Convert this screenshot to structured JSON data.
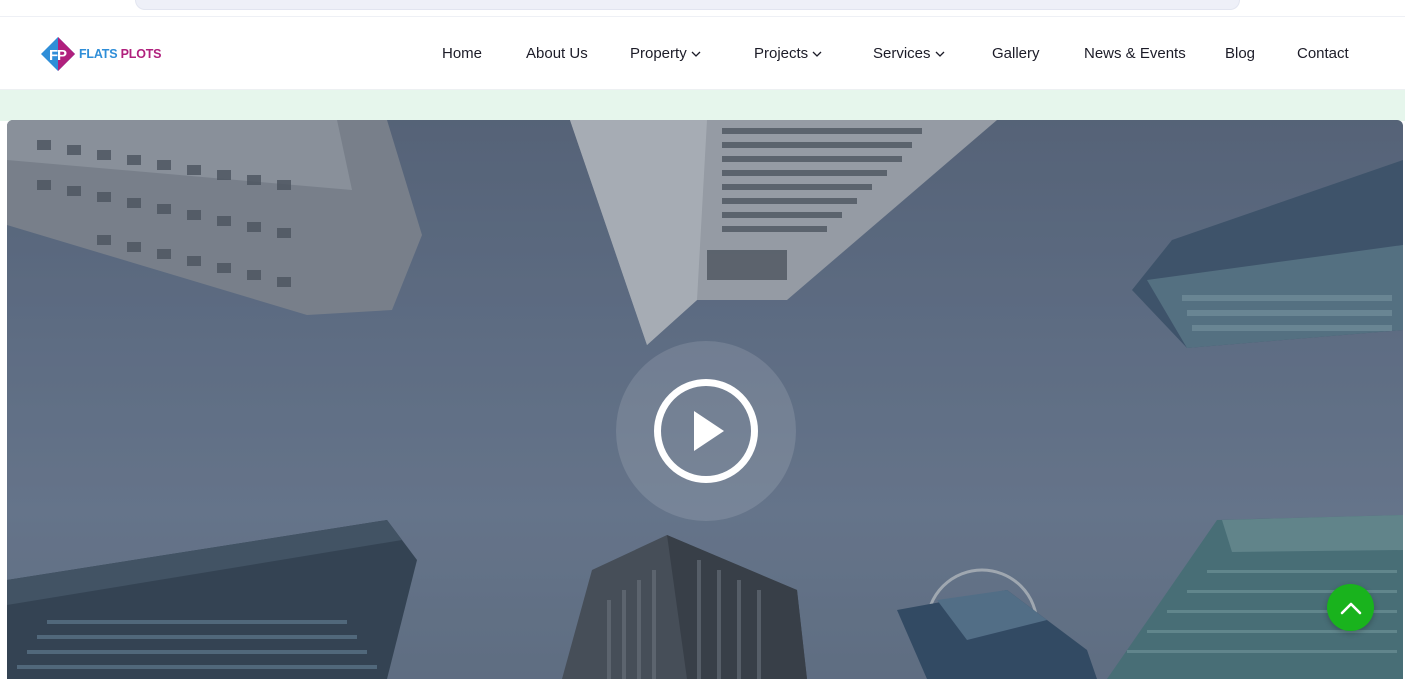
{
  "brand": {
    "logo_icon": "fp-monogram-icon",
    "name_part1": "FLATS",
    "name_part2": "PLOTS",
    "colors": {
      "blue": "#2f8ed8",
      "magenta": "#b0207d"
    }
  },
  "nav": {
    "items": [
      {
        "label": "Home",
        "has_dropdown": false
      },
      {
        "label": "About Us",
        "has_dropdown": false
      },
      {
        "label": "Property",
        "has_dropdown": true
      },
      {
        "label": "Projects",
        "has_dropdown": true
      },
      {
        "label": "Services",
        "has_dropdown": true
      },
      {
        "label": "Gallery",
        "has_dropdown": false
      },
      {
        "label": "News & Events",
        "has_dropdown": false
      },
      {
        "label": "Blog",
        "has_dropdown": false
      },
      {
        "label": "Contact",
        "has_dropdown": false
      }
    ]
  },
  "hero": {
    "background": "skyscrapers-looking-up-photo",
    "play_icon": "play-circle-icon"
  },
  "scroll_top": {
    "icon": "chevron-up-icon",
    "color": "#19b31d"
  },
  "colors": {
    "mint_band": "#e6f6ec",
    "nav_text": "#1c1c28"
  }
}
